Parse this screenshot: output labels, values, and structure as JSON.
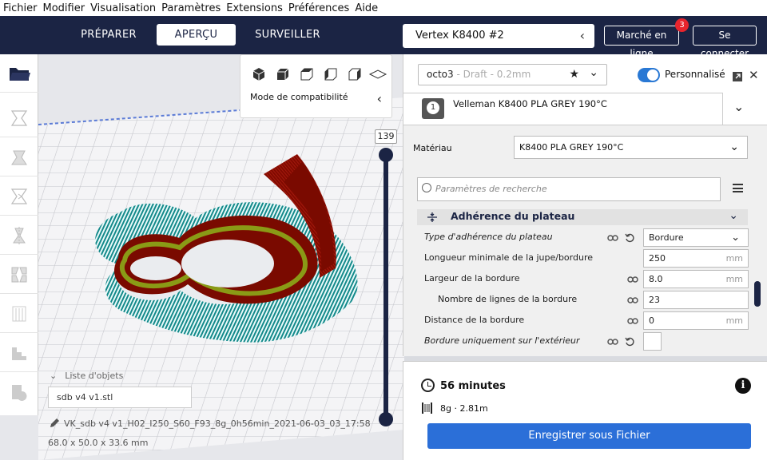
{
  "menu": [
    "Fichier",
    "Modifier",
    "Visualisation",
    "Paramètres",
    "Extensions",
    "Préférences",
    "Aide"
  ],
  "stages": {
    "prepare": "PRÉPARER",
    "preview": "APERÇU",
    "monitor": "SURVEILLER"
  },
  "printer": {
    "name": "Vertex K8400 #2"
  },
  "header": {
    "marketplace": "Marché en ligne",
    "marketplace_badge": "3",
    "signin": "Se connecter"
  },
  "view_popup": {
    "compat_label": "Mode de compatibilité"
  },
  "layer": {
    "current": "139"
  },
  "objects": {
    "header": "Liste d'objets",
    "file": "sdb v4 v1.stl",
    "job_name": "VK_sdb v4 v1_H02_I250_S60_F93_8g_0h56min_2021-06-03_03_17:58",
    "dimensions": "68.0 x 50.0 x 33.6 mm"
  },
  "profile": {
    "name": "octo3",
    "sub": " - Draft - 0.2mm",
    "custom_label": "Personnalisé"
  },
  "extruder": {
    "number": "1",
    "title": "Velleman K8400 PLA GREY 190°C"
  },
  "material": {
    "label": "Matériau",
    "value": "K8400 PLA GREY 190°C"
  },
  "search": {
    "placeholder": "Paramètres de recherche"
  },
  "category": {
    "title": "Adhérence du plateau"
  },
  "settings": [
    {
      "label": "Type d'adhérence du plateau",
      "value": "Bordure",
      "unit": ""
    },
    {
      "label": "Longueur minimale de la jupe/bordure",
      "value": "250",
      "unit": "mm"
    },
    {
      "label": "Largeur de la bordure",
      "value": "8.0",
      "unit": "mm"
    },
    {
      "label": "Nombre de lignes de la bordure",
      "value": "23",
      "unit": ""
    },
    {
      "label": "Distance de la bordure",
      "value": "0",
      "unit": "mm"
    },
    {
      "label": "Bordure uniquement sur l'extérieur",
      "value": "",
      "unit": ""
    }
  ],
  "summary": {
    "time": "56 minutes",
    "material_usage": "8g · 2.81m",
    "save_button": "Enregistrer sous Fichier"
  },
  "colors": {
    "header_bg": "#1b2444",
    "accent": "#2b6fd8",
    "model_red": "#7a0a00",
    "support_teal": "#138a8a",
    "badge": "#e8242d"
  }
}
